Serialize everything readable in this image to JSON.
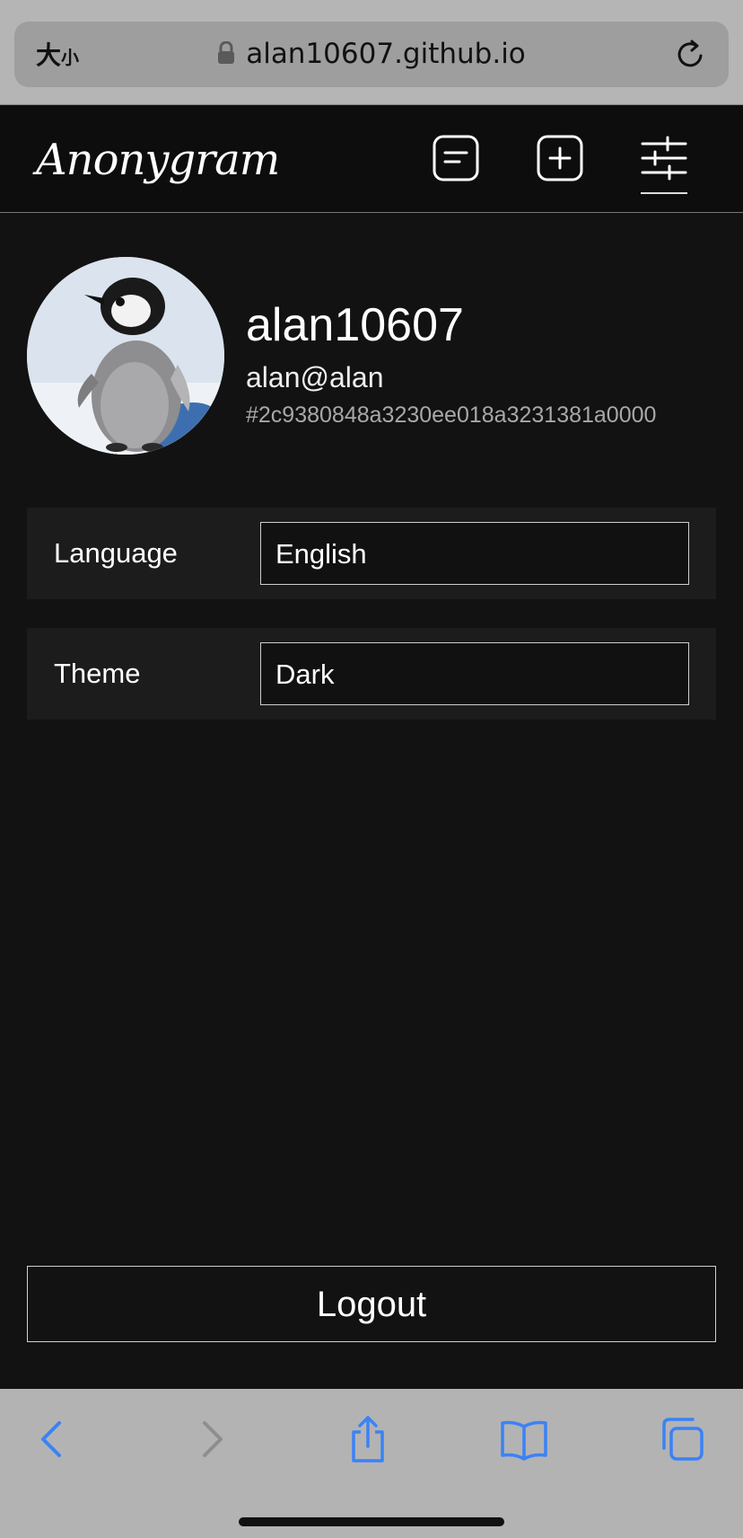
{
  "browser": {
    "text_size_label": "大",
    "text_size_label_small": "小",
    "url": "alan10607.github.io"
  },
  "app": {
    "logo": "Anonygram",
    "nav": [
      {
        "icon": "posts-icon"
      },
      {
        "icon": "add-post-icon"
      },
      {
        "icon": "settings-sliders-icon",
        "active": true
      }
    ]
  },
  "profile": {
    "username": "alan10607",
    "email": "alan@alan",
    "user_id": "#2c9380848a3230ee018a3231381a0000"
  },
  "settings": {
    "language": {
      "label": "Language",
      "value": "English"
    },
    "theme": {
      "label": "Theme",
      "value": "Dark"
    }
  },
  "actions": {
    "logout_label": "Logout"
  },
  "colors": {
    "background": "#121212",
    "header": "#0d0d0d",
    "row": "#1c1c1c",
    "safari_accent": "#3b82f6"
  }
}
